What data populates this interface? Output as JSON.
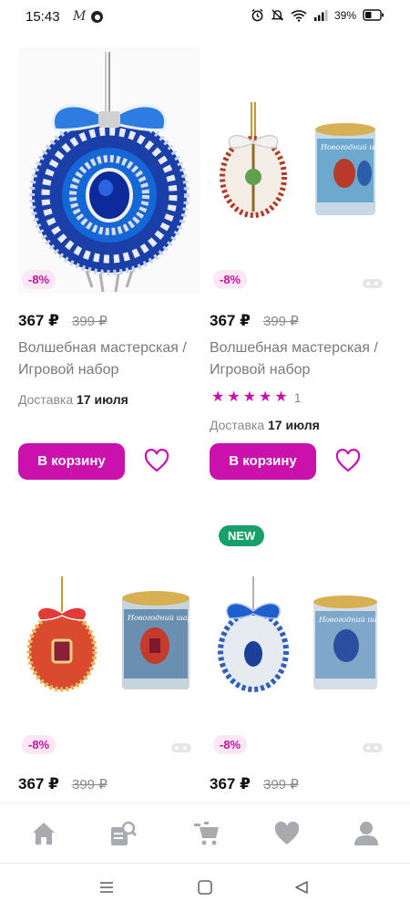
{
  "status_bar": {
    "time": "15:43",
    "app_letter": "M",
    "battery": "39%"
  },
  "products": [
    {
      "discount": "-8%",
      "price": "367 ₽",
      "old_price": "399 ₽",
      "title": "Волшебная мастерская / Игровой набор",
      "delivery_label": "Доставка",
      "delivery_date": "17 июля",
      "cart_label": "В корзину",
      "has_rating": false
    },
    {
      "discount": "-8%",
      "price": "367 ₽",
      "old_price": "399 ₽",
      "title": "Волшебная мастерская / Игровой набор",
      "rating_count": "1",
      "rating_stars": 5,
      "delivery_label": "Доставка",
      "delivery_date": "17 июля",
      "cart_label": "В корзину",
      "has_rating": true
    },
    {
      "discount": "-8%",
      "price": "367 ₽",
      "old_price": "399 ₽"
    },
    {
      "badge_new": "NEW",
      "discount": "-8%",
      "price": "367 ₽",
      "old_price": "399 ₽"
    }
  ],
  "packaging_text": "Новогодний шар",
  "bottom_nav": [
    "home-icon",
    "catalog-search-icon",
    "cart-icon",
    "favorites-icon",
    "profile-icon"
  ],
  "colors": {
    "accent": "#cb11ab",
    "discount_bg": "#fde6f6",
    "new_badge": "#17a06a",
    "nav_icon": "#a8aab0"
  }
}
